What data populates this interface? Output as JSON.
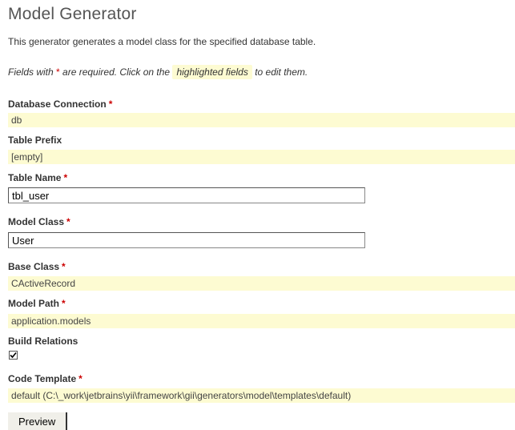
{
  "page": {
    "title": "Model Generator",
    "intro": "This generator generates a model class for the specified database table.",
    "hint": {
      "before": "Fields with ",
      "asterisk": "*",
      "middle": " are required. Click on the ",
      "highlight": "highlighted fields",
      "after": " to edit them."
    }
  },
  "form": {
    "required_marker": "*",
    "database_connection": {
      "label": "Database Connection",
      "value": "db"
    },
    "table_prefix": {
      "label": "Table Prefix",
      "value": "[empty]"
    },
    "table_name": {
      "label": "Table Name",
      "value": "tbl_user"
    },
    "model_class": {
      "label": "Model Class",
      "value": "User"
    },
    "base_class": {
      "label": "Base Class",
      "value": "CActiveRecord"
    },
    "model_path": {
      "label": "Model Path",
      "value": "application.models"
    },
    "build_relations": {
      "label": "Build Relations",
      "checked": true
    },
    "code_template": {
      "label": "Code Template",
      "value": "default (C:\\_work\\jetbrains\\yii\\framework\\gii\\generators\\model\\templates\\default)"
    },
    "preview_label": "Preview"
  },
  "colors": {
    "highlight_bg": "#fdfbd2",
    "required": "#cc0000"
  }
}
